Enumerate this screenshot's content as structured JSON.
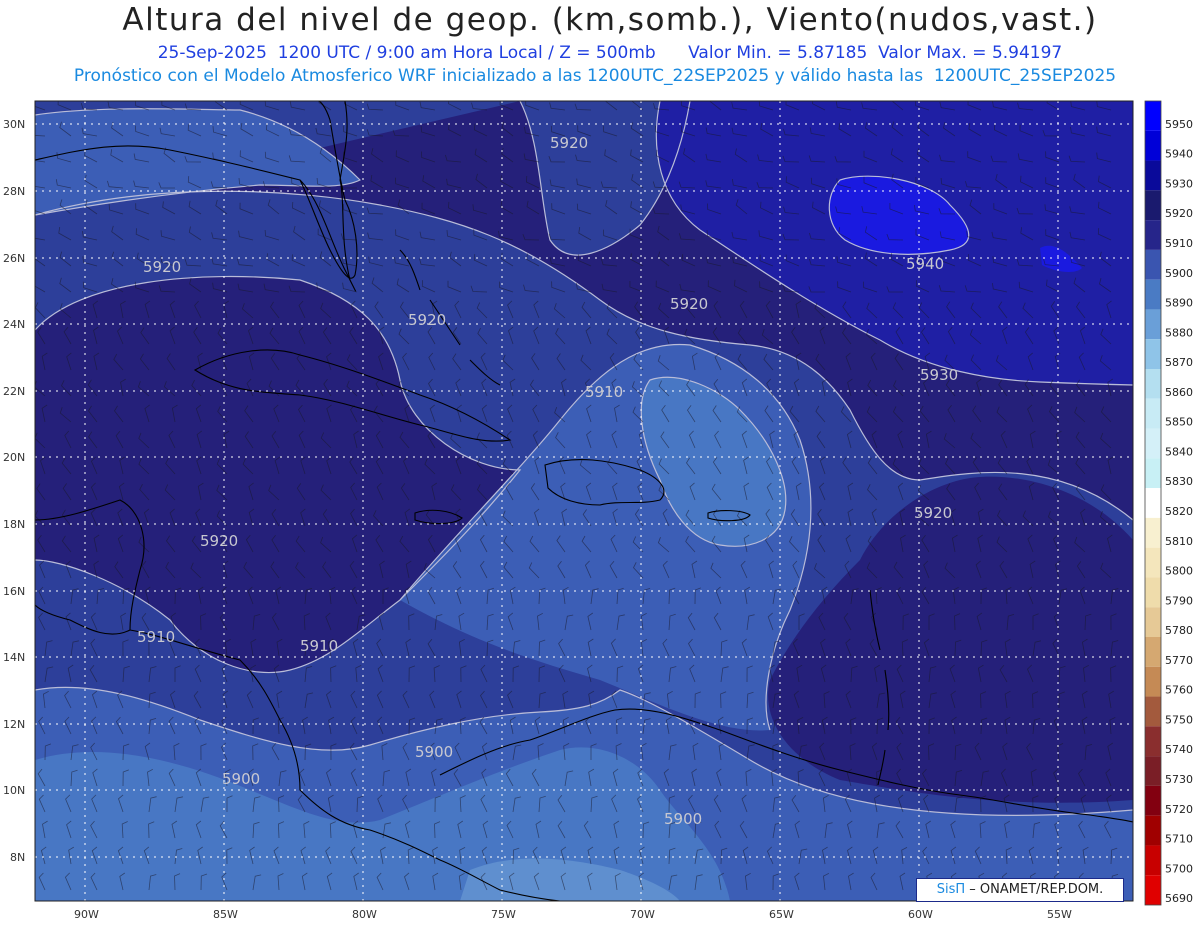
{
  "header": {
    "title": "Altura del nivel de geop. (km,somb.), Viento(nudos,vast.)",
    "subtitle1": "25-Sep-2025  1200 UTC / 9:00 am Hora Local / Z = 500mb      Valor Min. = 5.87185  Valor Max. = 5.94197",
    "subtitle2": "Pronóstico con el Modelo Atmosferico WRF inicializado a las 1200UTC_22SEP2025 y válido hasta las  1200UTC_25SEP2025"
  },
  "map": {
    "lat_ticks": [
      "30N",
      "28N",
      "26N",
      "24N",
      "22N",
      "20N",
      "18N",
      "16N",
      "14N",
      "12N",
      "10N",
      "8N"
    ],
    "lon_ticks": [
      "90W",
      "85W",
      "80W",
      "75W",
      "70W",
      "65W",
      "60W",
      "55W"
    ],
    "contour_labels": [
      {
        "text": "5920",
        "value": 5920
      },
      {
        "text": "5920",
        "value": 5920
      },
      {
        "text": "5920",
        "value": 5920
      },
      {
        "text": "5920",
        "value": 5920
      },
      {
        "text": "5920",
        "value": 5920
      },
      {
        "text": "5940",
        "value": 5940
      },
      {
        "text": "5930",
        "value": 5930
      },
      {
        "text": "5910",
        "value": 5910
      },
      {
        "text": "5910",
        "value": 5910
      },
      {
        "text": "5910",
        "value": 5910
      },
      {
        "text": "5920",
        "value": 5920
      },
      {
        "text": "5900",
        "value": 5900
      },
      {
        "text": "5900",
        "value": 5900
      },
      {
        "text": "5900",
        "value": 5900
      }
    ],
    "colors": {
      "c5880": "#5f8fcf",
      "c5890": "#4877c4",
      "c5900": "#3c5eb6",
      "c5910": "#2d3f9a",
      "c5920": "#25207a",
      "c5930": "#1f1fa4",
      "c5940": "#1a1ae0",
      "land": "#000000",
      "grid": "#ffffff"
    }
  },
  "colorbar": {
    "levels": [
      "5950",
      "5940",
      "5930",
      "5920",
      "5910",
      "5900",
      "5890",
      "5880",
      "5870",
      "5860",
      "5850",
      "5840",
      "5830",
      "5820",
      "5810",
      "5800",
      "5790",
      "5780",
      "5770",
      "5760",
      "5750",
      "5740",
      "5730",
      "5720",
      "5710",
      "5700",
      "5690"
    ],
    "colors": [
      "#0000ff",
      "#0000d8",
      "#0a0a9a",
      "#1a1a6e",
      "#26258a",
      "#3a55b0",
      "#4a7bc4",
      "#6a9fd8",
      "#8fc4e8",
      "#b4dff0",
      "#c8ebf5",
      "#d4f0f8",
      "#c8f0f5",
      "#ffffff",
      "#f8f0d0",
      "#f4e6bc",
      "#efdcab",
      "#e6c996",
      "#d5a871",
      "#c58a55",
      "#a35a3d",
      "#8a2e2e",
      "#7a1e26",
      "#820010",
      "#a00000",
      "#c80000",
      "#e00000"
    ]
  },
  "credit": {
    "brand": "SisΠ",
    "text": "– ONAMET/REP.DOM."
  }
}
